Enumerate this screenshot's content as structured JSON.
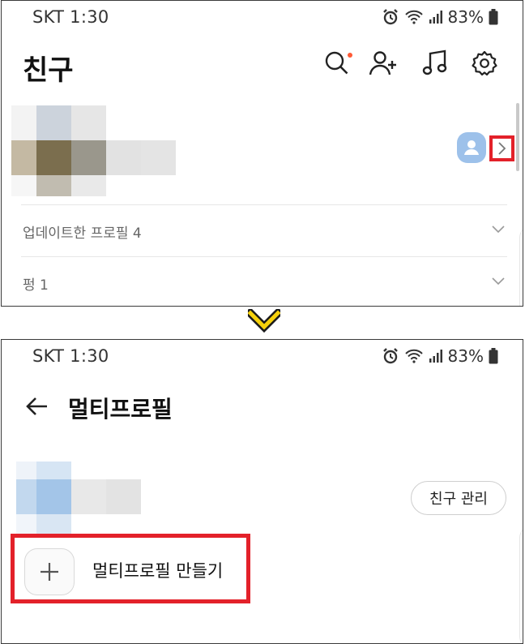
{
  "status": {
    "carrier_time": "SKT 1:30",
    "battery": "83%"
  },
  "friends": {
    "title": "친구",
    "header_icons": [
      "search-icon",
      "add-friend-icon",
      "music-icon",
      "settings-icon"
    ],
    "sections": [
      {
        "label": "업데이트한 프로필 4"
      },
      {
        "label": "펑 1"
      }
    ]
  },
  "multiprofile": {
    "title": "멀티프로필",
    "manage_label": "친구 관리",
    "create_label": "멀티프로필 만들기"
  },
  "colors": {
    "highlight": "#e3212a",
    "arrow": "#f6d10b",
    "accent_dot": "#ff5a36",
    "mini_avatar": "#9dc1ea"
  }
}
